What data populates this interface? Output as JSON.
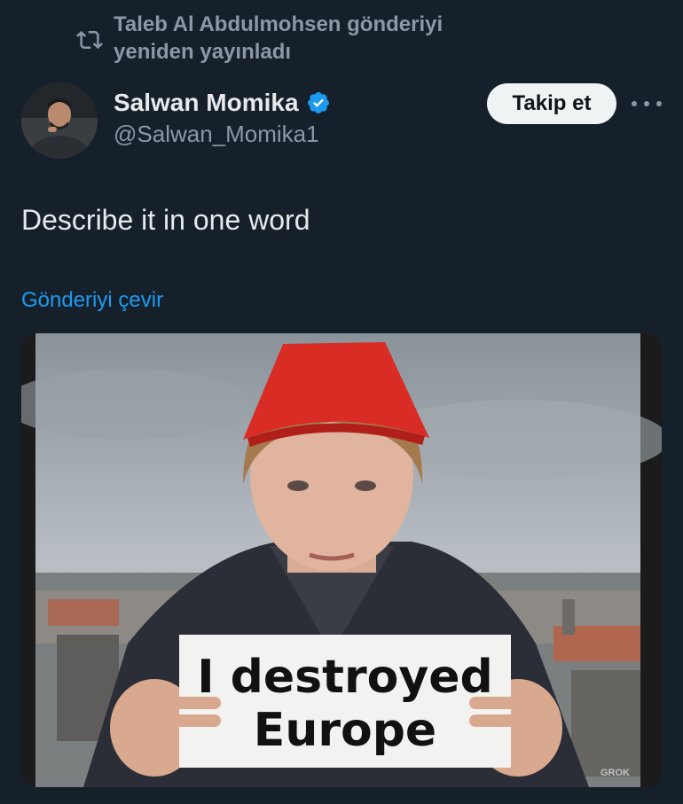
{
  "repost": {
    "text": "Taleb Al Abdulmohsen gönderiyi yeniden yayınladı",
    "icon": "repost-icon"
  },
  "author": {
    "name": "Salwan Momika",
    "handle": "@Salwan_Momika1",
    "verified": true
  },
  "actions": {
    "follow_label": "Takip et",
    "more_icon": "more-icon"
  },
  "tweet": {
    "text": "Describe it in one word",
    "translate_label": "Gönderiyi çevir"
  },
  "media": {
    "sign_line1": "I destroyed",
    "sign_line2": "Europe",
    "watermark": "GROK"
  },
  "colors": {
    "background": "#15202b",
    "accent": "#1d9bf0",
    "muted": "#8b98a5"
  }
}
